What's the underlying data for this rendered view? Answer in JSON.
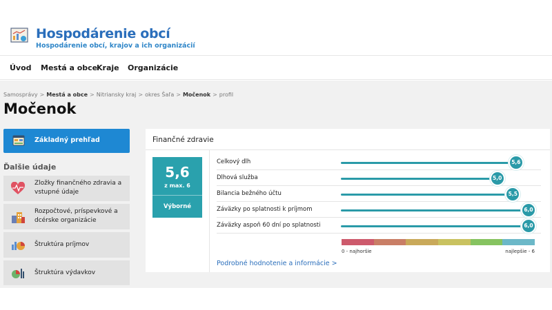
{
  "site": {
    "title": "Hospodárenie obcí",
    "subtitle": "Hospodárenie obcí, krajov a ich organizácií"
  },
  "nav": [
    "Úvod",
    "Mestá a obce",
    "Kraje",
    "Organizácie"
  ],
  "breadcrumb": [
    {
      "label": "Samosprávy",
      "bold": false
    },
    {
      "label": "Mestá a obce",
      "bold": true
    },
    {
      "label": "Nitriansky kraj",
      "bold": false
    },
    {
      "label": "okres Šaľa",
      "bold": false
    },
    {
      "label": "Močenok",
      "bold": true
    },
    {
      "label": "profil",
      "bold": false
    }
  ],
  "page_title": "Močenok",
  "sidebar": {
    "active": {
      "label": "Základný prehľad",
      "icon": "dashboard-icon"
    },
    "heading": "Ďalšie údaje",
    "items": [
      {
        "label": "Zložky finančného zdravia a vstupné údaje",
        "icon": "heart-pulse-icon"
      },
      {
        "label": "Rozpočtové, príspevkové a dcérske organizácie",
        "icon": "buildings-icon"
      },
      {
        "label": "Štruktúra príjmov",
        "icon": "income-chart-icon"
      },
      {
        "label": "Štruktúra výdavkov",
        "icon": "expense-chart-icon"
      }
    ]
  },
  "card": {
    "title": "Finančné zdravie",
    "score": "5,6",
    "score_max": "z max. 6",
    "rating": "Výborné",
    "metrics": [
      {
        "label": "Celkový dlh",
        "value": 5.6,
        "display": "5,6"
      },
      {
        "label": "Dlhová služba",
        "value": 5.0,
        "display": "5,0"
      },
      {
        "label": "Bilancia bežného účtu",
        "value": 5.5,
        "display": "5,5"
      },
      {
        "label": "Záväzky po splatnosti k príjmom",
        "value": 6.0,
        "display": "6,0"
      },
      {
        "label": "Záväzky aspoň 60 dní po splatnosti",
        "value": 6.0,
        "display": "6,0"
      }
    ],
    "max_value": 6,
    "scale_colors": [
      "#cd5a6c",
      "#c97e66",
      "#c9a95a",
      "#c9c260",
      "#86c360",
      "#6cb8c8"
    ],
    "scale_left": "0 - najhoršie",
    "scale_right": "najlepšie - 6",
    "details_link": "Podrobné hodnotenie a informácie  >"
  }
}
